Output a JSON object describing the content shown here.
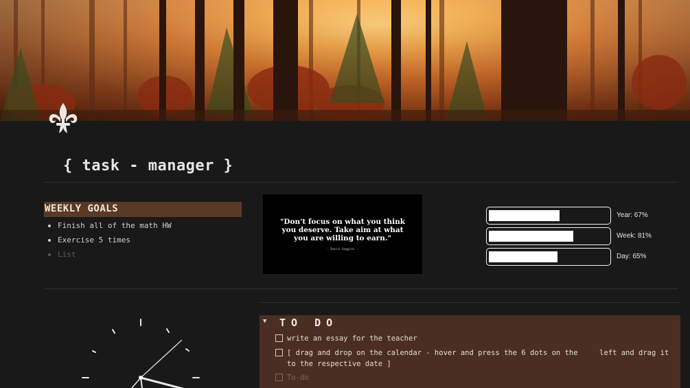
{
  "page": {
    "title": "{ task - manager }",
    "icon": "fleur-de-lis-icon",
    "cover": "autumn-forest-cover-image"
  },
  "weekly_goals": {
    "header": "WEEKLY GOALS",
    "items": [
      "Finish all of the math HW",
      "Exercise 5 times"
    ],
    "placeholder": "List"
  },
  "quote": {
    "text": "\"Don't focus on what you think you deserve. Take aim at what you are willing to earn.\"",
    "author": "- David Goggins -"
  },
  "progress": [
    {
      "label": "Year: 67%",
      "value": 0.67
    },
    {
      "label": "Week: 81%",
      "value": 0.81
    },
    {
      "label": "Day: 65%",
      "value": 0.65
    }
  ],
  "todo": {
    "title": "TO DO",
    "toggle_icon": "triangle-down-icon",
    "items": [
      "write an essay for the teacher",
      "[ drag and drop on the calendar - hover and press the 6 dots on the     left and drag it to the respective date ]"
    ],
    "placeholder": "To-do"
  },
  "colors": {
    "background": "#191919",
    "goals_header_bg": "#5a3a25",
    "todo_bg": "#4a2e22"
  }
}
